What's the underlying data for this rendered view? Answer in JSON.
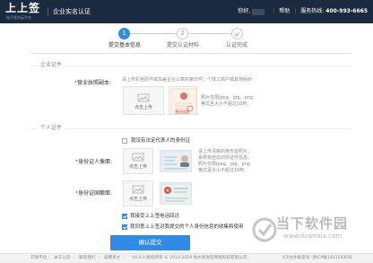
{
  "header": {
    "logo": "上上签",
    "logo_sub": "电子签约云平台",
    "title": "企业实名认证",
    "greeting": "你好,",
    "user": "",
    "help": "帮助",
    "service_label": "服务热线:",
    "phone": "400-993-6665"
  },
  "steps": [
    {
      "number": "1",
      "label": "提交基本信息",
      "active": true
    },
    {
      "number": "2",
      "label": "提交认证材料",
      "active": false
    },
    {
      "number": "3",
      "label": "认证完成",
      "active": false
    }
  ],
  "enterprise_section": {
    "title": "企业证件",
    "license_label": "营业执照副本:",
    "upload_text": "点击上传",
    "hint": [
      "请上传彩色原件或加盖企业公章的复印件；个体工商户或其他组织",
      "照片仅限jpeg、jpg、png",
      "格式且大小不超过10M。"
    ],
    "sample_caption": "营业执照"
  },
  "personal_section": {
    "title": "个人证件",
    "no_id_text": "我没有法定代表人的身份证",
    "id_front_label": "身份证人像面:",
    "id_back_label": "身份证国徽面:",
    "upload_text": "点击上传",
    "hint": [
      "请上传清晰的身份证照片，",
      "系统将自动识别证件信息。",
      "照片仅限jpeg、jpg、png",
      "格式且大小不超过10M。"
    ]
  },
  "agreements": [
    {
      "text": "我接受上上签电话回访",
      "checked": true
    },
    {
      "text": "我同意上上签对我提交的个人身份信息的收集和使用",
      "checked": true
    }
  ],
  "submit_label": "确认提交",
  "footer": {
    "links": [
      "开放平台",
      "关于公司",
      "联系我们",
      "诚聘英才"
    ],
    "copyright": "V4.0.0 版权所有 © 2014-2019 杭州尚尚签网络科技有限公司",
    "icp": "ICP主体备案号: 浙ICP备14031930号"
  },
  "watermark": {
    "text": "当下软件园",
    "url": "www.downxia.com"
  },
  "colors": {
    "header_bg": "#1a2a3f",
    "accent": "#2f8be6",
    "required": "#e23b3b"
  }
}
